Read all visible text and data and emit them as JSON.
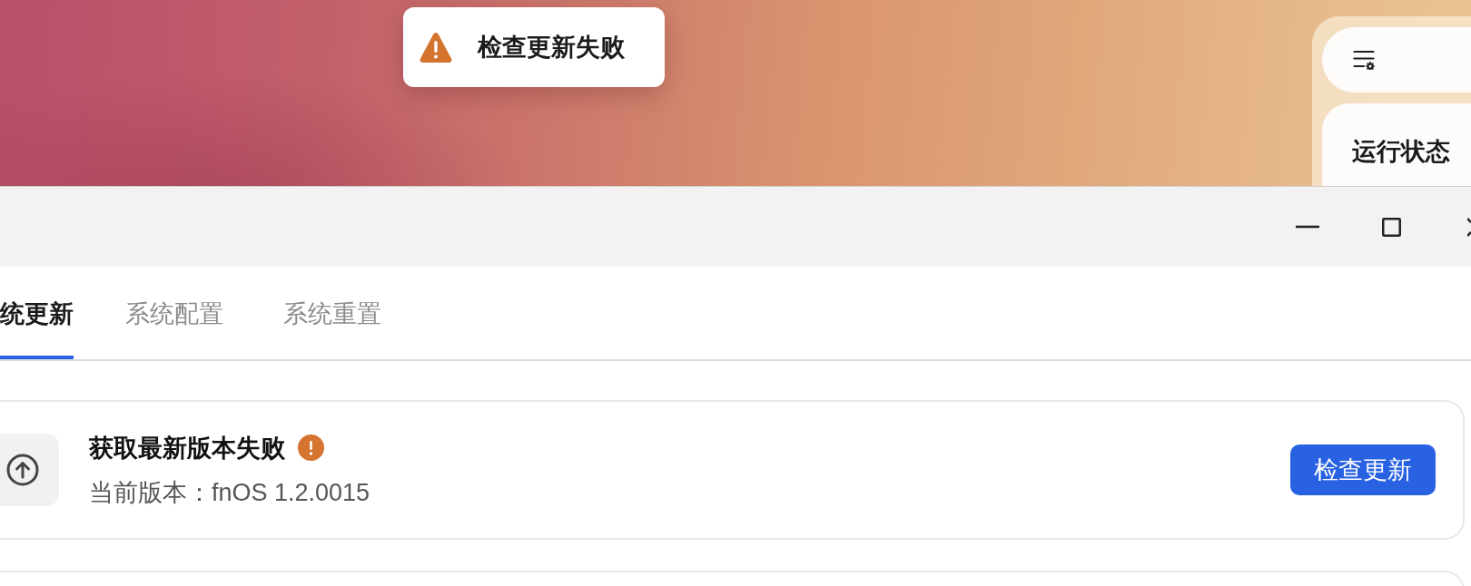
{
  "toast": {
    "message": "检查更新失败"
  },
  "widget": {
    "title": "运行状态"
  },
  "tabs": [
    {
      "label": "统更新",
      "selected": true
    },
    {
      "label": "系统配置",
      "selected": false
    },
    {
      "label": "系统重置",
      "selected": false
    }
  ],
  "update_card": {
    "title": "获取最新版本失败",
    "warning": true,
    "version": "当前版本：fnOS 1.2.0015",
    "button": "检查更新"
  }
}
